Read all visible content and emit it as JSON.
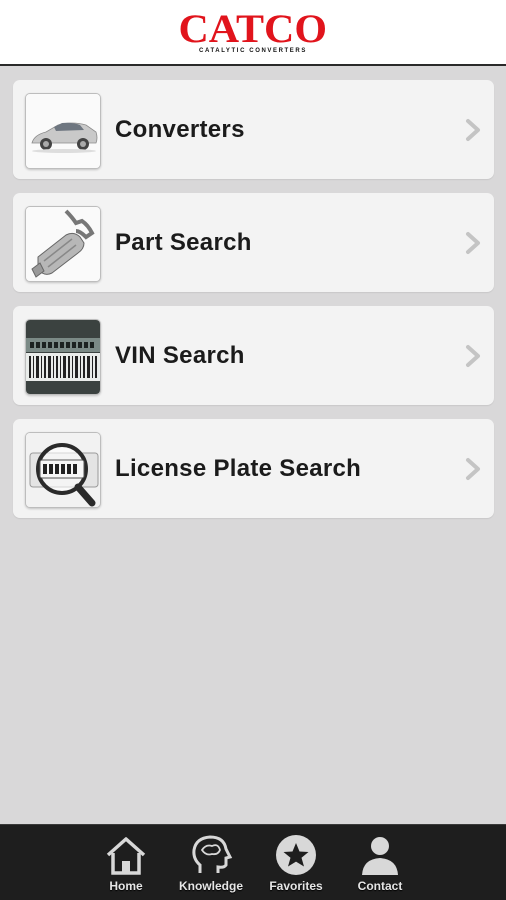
{
  "header": {
    "brand": "CATCO",
    "tagline": "CATALYTIC CONVERTERS",
    "brand_color": "#e1141c"
  },
  "menu": {
    "items": [
      {
        "label": "Converters",
        "icon": "car-icon"
      },
      {
        "label": "Part Search",
        "icon": "catalytic-converter-icon"
      },
      {
        "label": "VIN Search",
        "icon": "barcode-icon"
      },
      {
        "label": "License Plate Search",
        "icon": "license-plate-magnifier-icon"
      }
    ]
  },
  "tabbar": {
    "tabs": [
      {
        "label": "Home",
        "icon": "home-icon"
      },
      {
        "label": "Knowledge",
        "icon": "head-icon"
      },
      {
        "label": "Favorites",
        "icon": "star-icon"
      },
      {
        "label": "Contact",
        "icon": "person-icon"
      }
    ]
  },
  "colors": {
    "background": "#d9d8d9",
    "card": "#f3f3f3",
    "tabbar": "#1e1e1e",
    "text": "#1b1b1b"
  }
}
